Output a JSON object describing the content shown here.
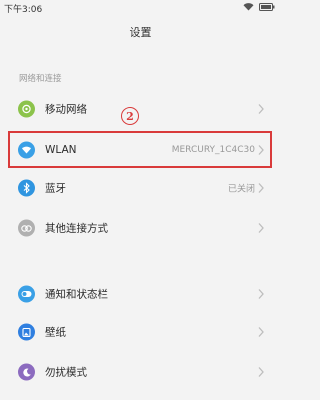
{
  "status_bar": {
    "time": "下午3:06"
  },
  "header": {
    "title": "设置"
  },
  "section": {
    "network_title": "网络和连接"
  },
  "rows": {
    "mobile": {
      "label": "移动网络"
    },
    "wlan": {
      "label": "WLAN",
      "value": "MERCURY_1C4C30"
    },
    "bluetooth": {
      "label": "蓝牙",
      "value": "已关闭"
    },
    "other": {
      "label": "其他连接方式"
    },
    "notify": {
      "label": "通知和状态栏"
    },
    "wallpaper": {
      "label": "壁纸"
    },
    "dnd": {
      "label": "勿扰模式"
    }
  },
  "annotation": {
    "marker": "2"
  },
  "colors": {
    "mobile_icon": "#8cc34b",
    "wlan_icon": "#3aa0e6",
    "bluetooth_icon": "#2f95e0",
    "other_icon": "#b0b0b0",
    "notify_icon": "#3aa0e6",
    "wallpaper_icon": "#2f7fe0",
    "dnd_icon": "#8c6bbf",
    "highlight": "#d93a3a"
  },
  "icons": {
    "mobile": "mobile-network-icon",
    "wlan": "wifi-icon",
    "bluetooth": "bluetooth-icon",
    "other": "link-icon",
    "notify": "toggle-icon",
    "wallpaper": "wallpaper-icon",
    "dnd": "moon-icon"
  }
}
